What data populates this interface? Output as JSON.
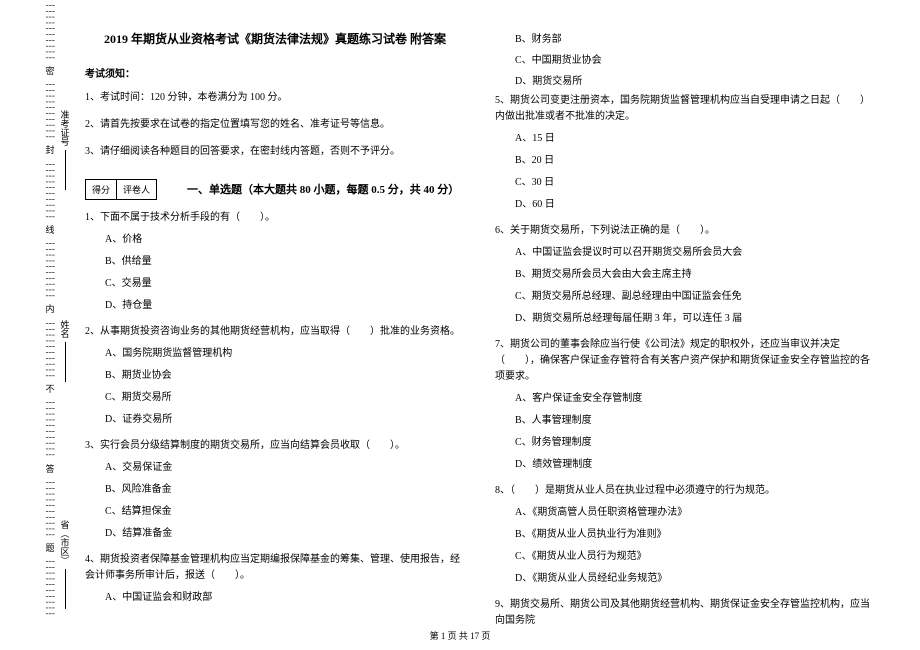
{
  "binding": {
    "vert_seal": "密",
    "vert_feng": "封",
    "vert_xian": "线",
    "vert_nei": "内",
    "vert_bu": "不",
    "vert_da": "答",
    "vert_ti": "题",
    "dots": "┆┆┆┆┆┆┆┆┆┆"
  },
  "side_labels": {
    "province": "省（市区）",
    "name": "姓名",
    "admission": "准考证号"
  },
  "header": {
    "title": "2019 年期货从业资格考试《期货法律法规》真题练习试卷 附答案",
    "notice_label": "考试须知：",
    "instructions": [
      "1、考试时间：120 分钟，本卷满分为 100 分。",
      "2、请首先按要求在试卷的指定位置填写您的姓名、准考证号等信息。",
      "3、请仔细阅读各种题目的回答要求，在密封线内答题，否则不予评分。"
    ],
    "score_box": {
      "score": "得分",
      "reviewer": "评卷人"
    },
    "section1": "一、单选题（本大题共 80 小题，每题 0.5 分，共 40 分）"
  },
  "questions_left": [
    {
      "stem": "1、下面不属于技术分析手段的有（　　）。",
      "options": [
        "A、价格",
        "B、供给量",
        "C、交易量",
        "D、持仓量"
      ]
    },
    {
      "stem": "2、从事期货投资咨询业务的其他期货经营机构，应当取得（　　）批准的业务资格。",
      "options": [
        "A、国务院期货监督管理机构",
        "B、期货业协会",
        "C、期货交易所",
        "D、证券交易所"
      ]
    },
    {
      "stem": "3、实行会员分级结算制度的期货交易所，应当向结算会员收取（　　）。",
      "options": [
        "A、交易保证金",
        "B、风险准备金",
        "C、结算担保金",
        "D、结算准备金"
      ]
    },
    {
      "stem": "4、期货投资者保障基金管理机构应当定期编报保障基金的筹集、管理、使用报告，经会计师事务所审计后，报送（　　）。",
      "options": [
        "A、中国证监会和财政部"
      ]
    }
  ],
  "questions_right_prefix_options": [
    "B、财务部",
    "C、中国期货业协会",
    "D、期货交易所"
  ],
  "questions_right": [
    {
      "stem": "5、期货公司变更注册资本，国务院期货监督管理机构应当自受理申请之日起（　　）内做出批准或者不批准的决定。",
      "options": [
        "A、15 日",
        "B、20 日",
        "C、30 日",
        "D、60 日"
      ]
    },
    {
      "stem": "6、关于期货交易所，下列说法正确的是（　　）。",
      "options": [
        "A、中国证监会提议时可以召开期货交易所会员大会",
        "B、期货交易所会员大会由大会主席主持",
        "C、期货交易所总经理、副总经理由中国证监会任免",
        "D、期货交易所总经理每届任期 3 年，可以连任 3 届"
      ]
    },
    {
      "stem": "7、期货公司的董事会除应当行使《公司法》规定的职权外，还应当审议并决定（　　），确保客户保证金存管符合有关客户资产保护和期货保证金安全存管监控的各项要求。",
      "options": [
        "A、客户保证金安全存管制度",
        "B、人事管理制度",
        "C、财务管理制度",
        "D、绩效管理制度"
      ]
    },
    {
      "stem": "8、（　　）是期货从业人员在执业过程中必须遵守的行为规范。",
      "options": [
        "A、《期货高管人员任职资格管理办法》",
        "B、《期货从业人员执业行为准则》",
        "C、《期货从业人员行为规范》",
        "D、《期货从业人员经纪业务规范》"
      ]
    },
    {
      "stem": "9、期货交易所、期货公司及其他期货经营机构、期货保证金安全存管监控机构，应当向国务院",
      "options": []
    }
  ],
  "footer": "第 1 页 共 17 页"
}
